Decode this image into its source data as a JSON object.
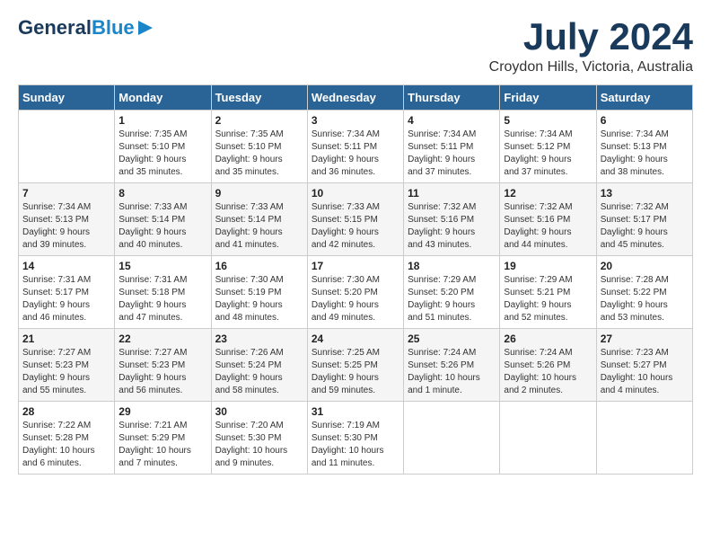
{
  "header": {
    "logo_line1": "General",
    "logo_line2": "Blue",
    "month_title": "July 2024",
    "location": "Croydon Hills, Victoria, Australia"
  },
  "calendar": {
    "weekdays": [
      "Sunday",
      "Monday",
      "Tuesday",
      "Wednesday",
      "Thursday",
      "Friday",
      "Saturday"
    ],
    "weeks": [
      [
        {
          "day": "",
          "info": ""
        },
        {
          "day": "1",
          "info": "Sunrise: 7:35 AM\nSunset: 5:10 PM\nDaylight: 9 hours\nand 35 minutes."
        },
        {
          "day": "2",
          "info": "Sunrise: 7:35 AM\nSunset: 5:10 PM\nDaylight: 9 hours\nand 35 minutes."
        },
        {
          "day": "3",
          "info": "Sunrise: 7:34 AM\nSunset: 5:11 PM\nDaylight: 9 hours\nand 36 minutes."
        },
        {
          "day": "4",
          "info": "Sunrise: 7:34 AM\nSunset: 5:11 PM\nDaylight: 9 hours\nand 37 minutes."
        },
        {
          "day": "5",
          "info": "Sunrise: 7:34 AM\nSunset: 5:12 PM\nDaylight: 9 hours\nand 37 minutes."
        },
        {
          "day": "6",
          "info": "Sunrise: 7:34 AM\nSunset: 5:13 PM\nDaylight: 9 hours\nand 38 minutes."
        }
      ],
      [
        {
          "day": "7",
          "info": "Sunrise: 7:34 AM\nSunset: 5:13 PM\nDaylight: 9 hours\nand 39 minutes."
        },
        {
          "day": "8",
          "info": "Sunrise: 7:33 AM\nSunset: 5:14 PM\nDaylight: 9 hours\nand 40 minutes."
        },
        {
          "day": "9",
          "info": "Sunrise: 7:33 AM\nSunset: 5:14 PM\nDaylight: 9 hours\nand 41 minutes."
        },
        {
          "day": "10",
          "info": "Sunrise: 7:33 AM\nSunset: 5:15 PM\nDaylight: 9 hours\nand 42 minutes."
        },
        {
          "day": "11",
          "info": "Sunrise: 7:32 AM\nSunset: 5:16 PM\nDaylight: 9 hours\nand 43 minutes."
        },
        {
          "day": "12",
          "info": "Sunrise: 7:32 AM\nSunset: 5:16 PM\nDaylight: 9 hours\nand 44 minutes."
        },
        {
          "day": "13",
          "info": "Sunrise: 7:32 AM\nSunset: 5:17 PM\nDaylight: 9 hours\nand 45 minutes."
        }
      ],
      [
        {
          "day": "14",
          "info": "Sunrise: 7:31 AM\nSunset: 5:17 PM\nDaylight: 9 hours\nand 46 minutes."
        },
        {
          "day": "15",
          "info": "Sunrise: 7:31 AM\nSunset: 5:18 PM\nDaylight: 9 hours\nand 47 minutes."
        },
        {
          "day": "16",
          "info": "Sunrise: 7:30 AM\nSunset: 5:19 PM\nDaylight: 9 hours\nand 48 minutes."
        },
        {
          "day": "17",
          "info": "Sunrise: 7:30 AM\nSunset: 5:20 PM\nDaylight: 9 hours\nand 49 minutes."
        },
        {
          "day": "18",
          "info": "Sunrise: 7:29 AM\nSunset: 5:20 PM\nDaylight: 9 hours\nand 51 minutes."
        },
        {
          "day": "19",
          "info": "Sunrise: 7:29 AM\nSunset: 5:21 PM\nDaylight: 9 hours\nand 52 minutes."
        },
        {
          "day": "20",
          "info": "Sunrise: 7:28 AM\nSunset: 5:22 PM\nDaylight: 9 hours\nand 53 minutes."
        }
      ],
      [
        {
          "day": "21",
          "info": "Sunrise: 7:27 AM\nSunset: 5:23 PM\nDaylight: 9 hours\nand 55 minutes."
        },
        {
          "day": "22",
          "info": "Sunrise: 7:27 AM\nSunset: 5:23 PM\nDaylight: 9 hours\nand 56 minutes."
        },
        {
          "day": "23",
          "info": "Sunrise: 7:26 AM\nSunset: 5:24 PM\nDaylight: 9 hours\nand 58 minutes."
        },
        {
          "day": "24",
          "info": "Sunrise: 7:25 AM\nSunset: 5:25 PM\nDaylight: 9 hours\nand 59 minutes."
        },
        {
          "day": "25",
          "info": "Sunrise: 7:24 AM\nSunset: 5:26 PM\nDaylight: 10 hours\nand 1 minute."
        },
        {
          "day": "26",
          "info": "Sunrise: 7:24 AM\nSunset: 5:26 PM\nDaylight: 10 hours\nand 2 minutes."
        },
        {
          "day": "27",
          "info": "Sunrise: 7:23 AM\nSunset: 5:27 PM\nDaylight: 10 hours\nand 4 minutes."
        }
      ],
      [
        {
          "day": "28",
          "info": "Sunrise: 7:22 AM\nSunset: 5:28 PM\nDaylight: 10 hours\nand 6 minutes."
        },
        {
          "day": "29",
          "info": "Sunrise: 7:21 AM\nSunset: 5:29 PM\nDaylight: 10 hours\nand 7 minutes."
        },
        {
          "day": "30",
          "info": "Sunrise: 7:20 AM\nSunset: 5:30 PM\nDaylight: 10 hours\nand 9 minutes."
        },
        {
          "day": "31",
          "info": "Sunrise: 7:19 AM\nSunset: 5:30 PM\nDaylight: 10 hours\nand 11 minutes."
        },
        {
          "day": "",
          "info": ""
        },
        {
          "day": "",
          "info": ""
        },
        {
          "day": "",
          "info": ""
        }
      ]
    ]
  }
}
